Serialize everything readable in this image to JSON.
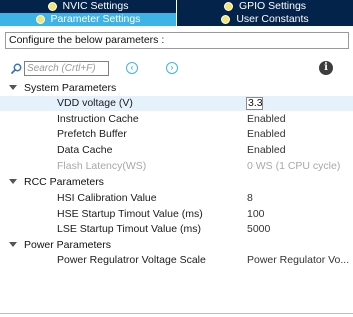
{
  "tabs": {
    "row1": [
      {
        "label": "NVIC Settings",
        "active": false
      },
      {
        "label": "GPIO Settings",
        "active": false
      }
    ],
    "row2": [
      {
        "label": "Parameter Settings",
        "active": true
      },
      {
        "label": "User Constants",
        "active": false
      }
    ]
  },
  "config_bar": {
    "text": "Configure the below parameters :"
  },
  "search": {
    "placeholder": "Search (Crtl+F)"
  },
  "icons": {
    "search": "search-icon",
    "prev": "chevron-left-icon",
    "next": "chevron-right-icon",
    "info": "info-icon",
    "category_toggle": "chevron-down-icon",
    "status_dot": "checkmark-dot-icon"
  },
  "colors": {
    "tab_dark": "#03234b",
    "tab_active": "#3cb4e6",
    "status_dot": "#f2e66b",
    "selected_row": "#e5f1fb"
  },
  "tree": {
    "categories": [
      {
        "label": "System Parameters",
        "params": [
          {
            "name": "VDD voltage (V)",
            "value": "3.3",
            "selected": true,
            "editing": true
          },
          {
            "name": "Instruction Cache",
            "value": "Enabled"
          },
          {
            "name": "Prefetch Buffer",
            "value": "Enabled"
          },
          {
            "name": "Data Cache",
            "value": "Enabled"
          },
          {
            "name": "Flash Latency(WS)",
            "value": "0 WS (1 CPU cycle)",
            "disabled": true
          }
        ]
      },
      {
        "label": "RCC Parameters",
        "params": [
          {
            "name": "HSI Calibration Value",
            "value": "8"
          },
          {
            "name": "HSE Startup Timout Value (ms)",
            "value": "100"
          },
          {
            "name": "LSE Startup Timout Value (ms)",
            "value": "5000"
          }
        ]
      },
      {
        "label": "Power Parameters",
        "params": [
          {
            "name": "Power Regulatror Voltage Scale",
            "value": "Power Regulator Vo..."
          }
        ]
      }
    ]
  }
}
